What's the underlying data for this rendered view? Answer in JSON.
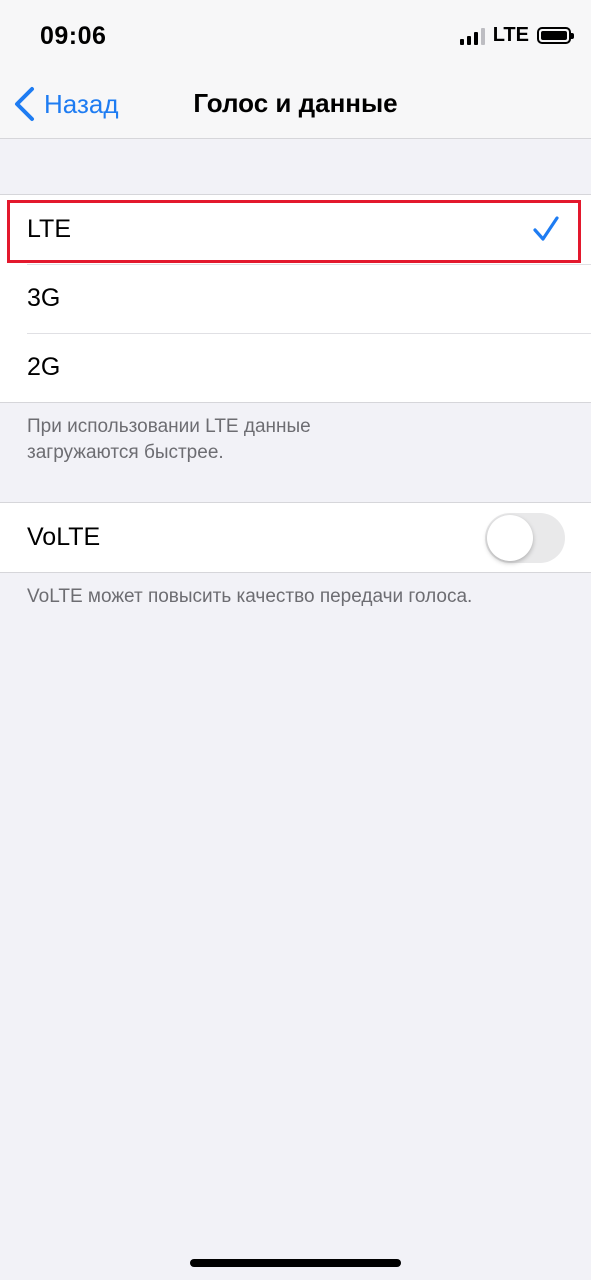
{
  "status_bar": {
    "time": "09:06",
    "network": "LTE",
    "signal_bars_active": 3,
    "signal_bars_total": 4
  },
  "nav": {
    "back_label": "Назад",
    "title": "Голос и данные"
  },
  "network_options": [
    {
      "label": "LTE",
      "selected": true
    },
    {
      "label": "3G",
      "selected": false
    },
    {
      "label": "2G",
      "selected": false
    }
  ],
  "network_footnote": "При использовании LTE данные загружаются быстрее.",
  "volte": {
    "label": "VoLTE",
    "enabled": false,
    "footnote": "VoLTE может повысить качество передачи голоса."
  },
  "colors": {
    "accent": "#1e7cf2",
    "highlight_border": "#e3182d",
    "background": "#f2f2f7"
  }
}
